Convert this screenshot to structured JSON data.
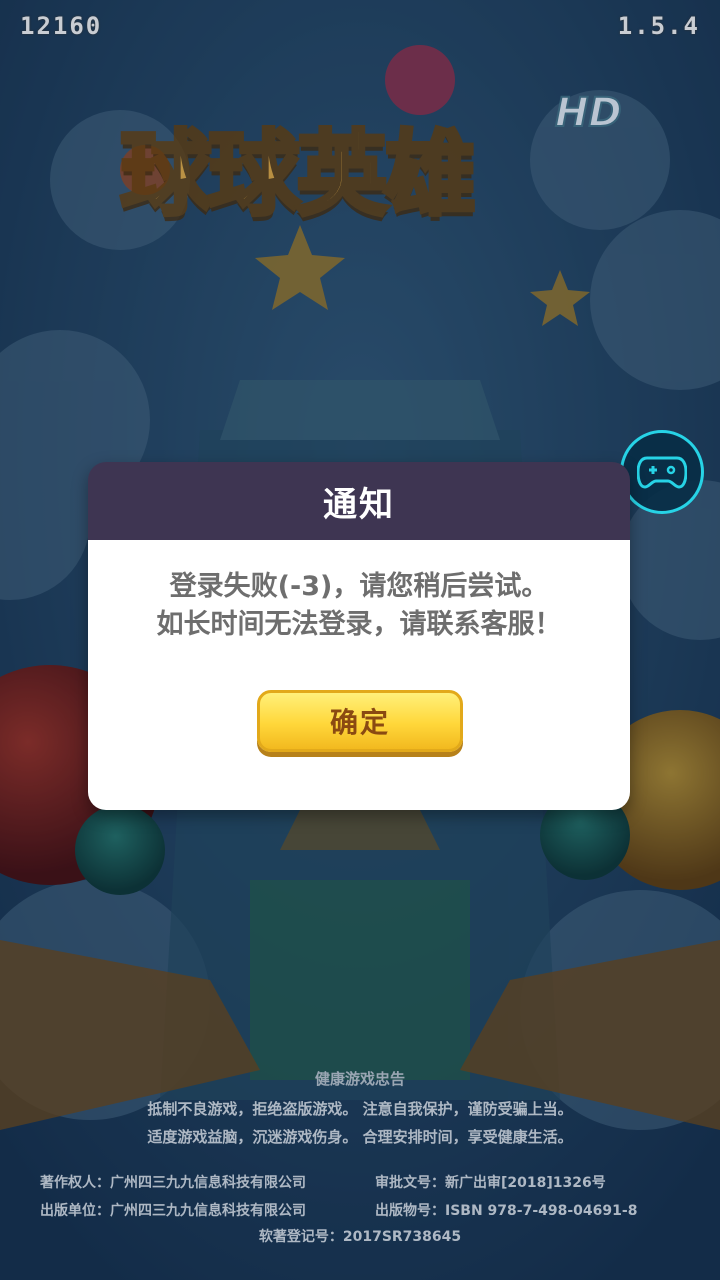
{
  "hud": {
    "score": "12160",
    "version": "1.5.4"
  },
  "logo": {
    "title": "球球英雄",
    "badge": "HD"
  },
  "dialog": {
    "title": "通知",
    "message_line1": "登录失败(-3)，请您稍后尝试。",
    "message_line2": "如长时间无法登录，请联系客服！",
    "ok_label": "确定"
  },
  "footer": {
    "heading": "健康游戏忠告",
    "line1": "抵制不良游戏，拒绝盗版游戏。 注意自我保护，谨防受骗上当。",
    "line2": "适度游戏益脑，沉迷游戏伤身。 合理安排时间，享受健康生活。",
    "copyright_owner": "著作权人：广州四三九九信息科技有限公司",
    "approval_no": "审批文号：新广出审[2018]1326号",
    "publisher": "出版单位：广州四三九九信息科技有限公司",
    "isbn": "出版物号：ISBN 978-7-498-04691-8",
    "software_reg": "软著登记号：2017SR738645"
  },
  "colors": {
    "dialog_header": "#3e3552",
    "button_yellow": "#ffd73a",
    "gamepad_ring": "#27d3e6"
  },
  "icons": {
    "gamepad": "gamepad-icon"
  }
}
